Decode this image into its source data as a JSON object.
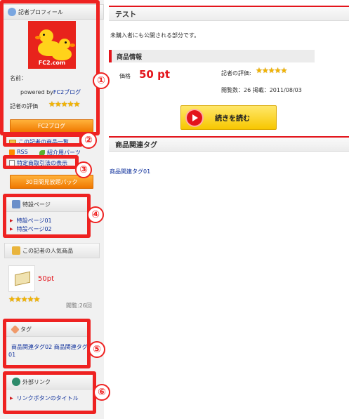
{
  "sidebar": {
    "profile": {
      "header": "記者プロフィール",
      "image_text": "FC2.com",
      "name_label": "名前：",
      "powered_prefix": "powered by",
      "powered_link": "FC2ブログ",
      "rating_label": "記者の評価",
      "rating_stars": "★★★★★",
      "blog_button": "FC2ブログ"
    },
    "product_list_link": "この記者の商品一覧",
    "rss_link": "RSS",
    "parts_link": "紹介用パーツ",
    "tokutei_link": "特定商取引法の表示",
    "pack_button": "30日間見放題パック",
    "special": {
      "header": "特設ページ",
      "items": [
        "特設ページ01",
        "特設ページ02"
      ]
    },
    "popular": {
      "header": "この記者の人気商品",
      "price": "50pt",
      "stars": "★★★★★",
      "views": "閲覧:26回"
    },
    "tags": {
      "header": "タグ",
      "line1": "商品関連タグ02  商品関連タグ",
      "line2": "01"
    },
    "external": {
      "header": "外部リンク",
      "link": "リンクボタンのタイトル"
    }
  },
  "main": {
    "title": "テスト",
    "description": "未購入者にも公開される部分です。",
    "product_info_header": "商品情報",
    "price_label": "価格",
    "price_value": "50 pt",
    "rating_label": "記者の評価:",
    "rating_stars": "★★★★★",
    "views_date": "閲覧数：26  掲載：2011/08/03",
    "read_button": "続きを読む",
    "tags_header": "商品関連タグ",
    "tag_link": "商品関連タグ01"
  },
  "markers": [
    "①",
    "②",
    "③",
    "④",
    "⑤",
    "⑥"
  ],
  "colors": {
    "accent_red": "#e3141b",
    "link_blue": "#0b2d9a",
    "button_orange": "#f07800",
    "star_gold": "#f2b400"
  }
}
